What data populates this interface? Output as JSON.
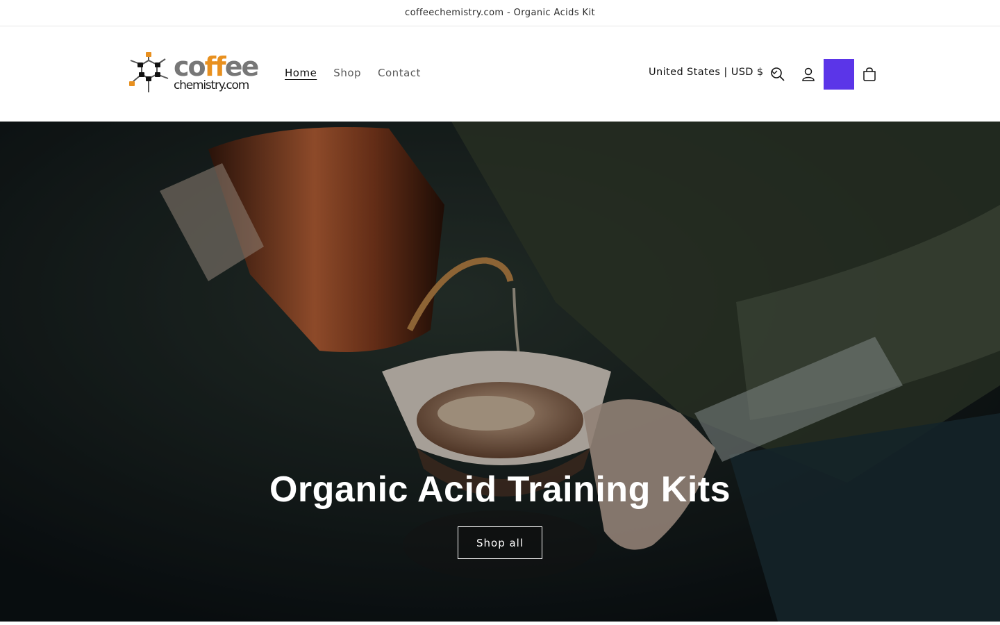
{
  "announcement": {
    "text": "coffeechemistry.com - Organic Acids Kit"
  },
  "logo": {
    "line1_start": "co",
    "line1_accent": "ff",
    "line1_end": "ee",
    "line2": "chemistry.com"
  },
  "nav": {
    "items": [
      {
        "label": "Home",
        "active": true
      },
      {
        "label": "Shop",
        "active": false
      },
      {
        "label": "Contact",
        "active": false
      }
    ]
  },
  "localization": {
    "label": "United States | USD $"
  },
  "icons": {
    "search": "search-icon",
    "account": "account-icon",
    "cart": "cart-icon",
    "chevron": "chevron-down-icon"
  },
  "colors": {
    "accent_button": "#5b35e8",
    "logo_orange": "#e8901f",
    "logo_gray": "#777777"
  },
  "hero": {
    "title": "Organic Acid Training Kits",
    "button_label": "Shop all"
  }
}
